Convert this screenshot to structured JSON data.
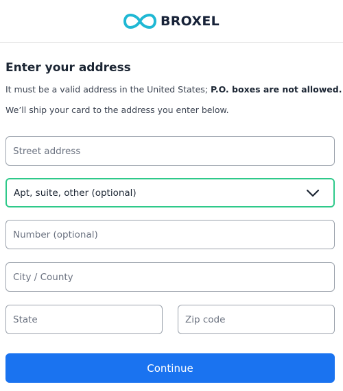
{
  "brand": {
    "name": "BROXEL",
    "logo_icon": "infinity-icon",
    "logo_color": "#1fb8d4"
  },
  "form": {
    "title": "Enter your address",
    "intro_text": "It must be a valid address in the United States; ",
    "intro_bold": "P.O. boxes are not allowed.",
    "shipping_note": "We’ll ship your card to the address you enter below.",
    "street_placeholder": "Street address",
    "apt_select_value": "Apt, suite, other (optional)",
    "number_placeholder": "Number (optional)",
    "city_placeholder": "City / County",
    "state_placeholder": "State",
    "zip_placeholder": "Zip code",
    "continue_label": "Continue"
  },
  "colors": {
    "accent": "#1a73f0",
    "focus_border": "#2ec98a",
    "field_border": "#9aa1ab",
    "text": "#1b2533"
  }
}
